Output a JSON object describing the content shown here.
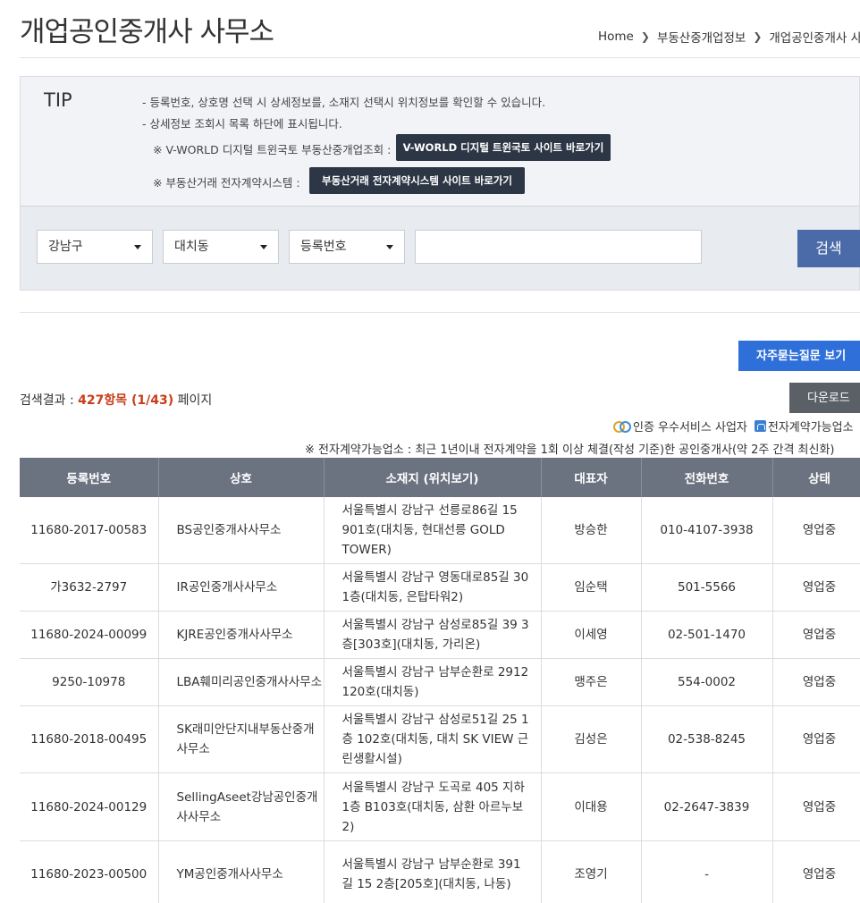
{
  "header": {
    "title": "개업공인중개사 사무소",
    "breadcrumb": [
      "Home",
      "부동산중개업정보",
      "개업공인중개사 사무소"
    ]
  },
  "tip": {
    "label": "TIP",
    "lines": [
      "- 등록번호, 상호명 선택 시 상세정보를, 소재지 선택시 위치정보를 확인할 수 있습니다.",
      "- 상세정보 조회시 목록 하단에 표시됩니다."
    ],
    "vworld_note": "※ V-WORLD 디지털 트윈국토 부동산중개업조회 :",
    "vworld_button": "V-WORLD 디지털 트윈국토 사이트 바로가기",
    "econtract_note": "※ 부동산거래 전자계약시스템 :",
    "econtract_button": "부동산거래 전자계약시스템 사이트 바로가기"
  },
  "search": {
    "district": "강남구",
    "dong": "대치동",
    "type": "등록번호",
    "query": "",
    "button": "검색"
  },
  "actions": {
    "faq_button": "자주묻는질문 보기",
    "download_button": "다운로드"
  },
  "results": {
    "prefix": "검색결과 : ",
    "count": "427항목 (1/43)",
    "suffix": " 페이지"
  },
  "legend": {
    "certified": "인증 우수서비스 사업자",
    "econtract": "전자계약가능업소"
  },
  "note": "※ 전자계약가능업소 : 최근 1년이내 전자계약을 1회 이상 체결(작성 기준)한 공인중개사(약 2주 간격 최신화)",
  "table": {
    "headers": [
      "등록번호",
      "상호",
      "소재지 (위치보기)",
      "대표자",
      "전화번호",
      "상태"
    ],
    "rows": [
      {
        "reg": "11680-2017-00583",
        "name": "BS공인중개사사무소",
        "addr": "서울특별시 강남구 선릉로86길 15 901호(대치동, 현대선릉 GOLD TOWER)",
        "rep": "방승한",
        "tel": "010-4107-3938",
        "status": "영업중"
      },
      {
        "reg": "가3632-2797",
        "name": "IR공인중개사사무소",
        "addr": "서울특별시 강남구 영동대로85길 30 1층(대치동, 은탑타워2)",
        "rep": "임순택",
        "tel": "501-5566",
        "status": "영업중"
      },
      {
        "reg": "11680-2024-00099",
        "name": "KJRE공인중개사사무소",
        "addr": "서울특별시 강남구 삼성로85길 39 3층[303호](대치동, 가리온)",
        "rep": "이세영",
        "tel": "02-501-1470",
        "status": "영업중"
      },
      {
        "reg": "9250-10978",
        "name": "LBA훼미리공인중개사사무소",
        "addr": "서울특별시 강남구 남부순환로 2912 120호(대치동)",
        "rep": "맹주은",
        "tel": "554-0002",
        "status": "영업중"
      },
      {
        "reg": "11680-2018-00495",
        "name": "SK래미안단지내부동산중개사무소",
        "addr": "서울특별시 강남구 삼성로51길 25 1층 102호(대치동, 대치 SK VIEW 근린생활시설)",
        "rep": "김성은",
        "tel": "02-538-8245",
        "status": "영업중"
      },
      {
        "reg": "11680-2024-00129",
        "name": "SellingAseet강남공인중개사사무소",
        "addr": "서울특별시 강남구 도곡로 405 지하1층 B103호(대치동, 삼환 아르누보2)",
        "rep": "이대용",
        "tel": "02-2647-3839",
        "status": "영업중"
      },
      {
        "reg": "11680-2023-00500",
        "name": "YM공인중개사사무소",
        "addr": "서울특별시 강남구 남부순환로 391길 15 2층[205호](대치동, 나동)",
        "rep": "조영기",
        "tel": "-",
        "status": "영업중"
      }
    ]
  }
}
